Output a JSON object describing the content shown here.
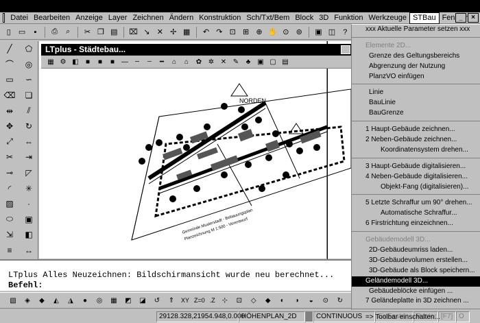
{
  "menubar": {
    "items": [
      "Datei",
      "Bearbeiten",
      "Anzeige",
      "Layer",
      "Zeichnen",
      "Ändern",
      "Konstruktion",
      "Sch/Txt/Bem",
      "Block",
      "3D",
      "Funktion",
      "Werkzeuge",
      "STBau",
      "Fenster",
      "?"
    ],
    "active_item": "STBau"
  },
  "drawing_window": {
    "title": "LTplus - Städtebau..."
  },
  "command_line": {
    "history": "LTplus Alles Neuzeichnen: Bildschirmansicht wurde neu berechnet...",
    "prompt": "Befehl:"
  },
  "status_bar": {
    "coordinates": "29128.328,21954.948,0.000",
    "layer": "HÖHENPLAN_2D",
    "linetype": "CONTINUOUS",
    "snap": "EinFasten",
    "grid": "Raster",
    "f7": "[F7]",
    "extra": "O"
  },
  "bottom_toolbar": {
    "xy": "XY",
    "z0": "Z=0",
    "z": ".Z"
  },
  "stbau_menu": {
    "items": [
      {
        "label": "xxx Aktuelle Parameter setzen xxx",
        "type": "item"
      },
      {
        "type": "sep"
      },
      {
        "label": "Elemente 2D...",
        "type": "disabled"
      },
      {
        "label": "Grenze des Geltungsbereichs",
        "type": "item"
      },
      {
        "label": "Abgrenzung der Nutzung",
        "type": "item"
      },
      {
        "label": "PlanzVO einfügen",
        "type": "item"
      },
      {
        "type": "sep"
      },
      {
        "label": "Linie",
        "type": "item"
      },
      {
        "label": "BauLinie",
        "type": "item"
      },
      {
        "label": "BauGrenze",
        "type": "item"
      },
      {
        "type": "sep"
      },
      {
        "label": "1 Haupt-Gebäude zeichnen...",
        "type": "item"
      },
      {
        "label": "2 Neben-Gebäude zeichnen...",
        "type": "item"
      },
      {
        "label": "Koordinatensystem drehen...",
        "type": "item"
      },
      {
        "type": "sep"
      },
      {
        "label": "3 Haupt-Gebäude digitalisieren...",
        "type": "item"
      },
      {
        "label": "4 Neben-Gebäude digitalisieren...",
        "type": "item"
      },
      {
        "label": "Objekt-Fang (digitalisieren)...",
        "type": "item"
      },
      {
        "type": "sep"
      },
      {
        "label": "5 Letzte Schraffur um 90° drehen...",
        "type": "item"
      },
      {
        "label": "Automatische Schraffur...",
        "type": "item"
      },
      {
        "label": "6 Firstrichtung einzeichnen...",
        "type": "item"
      },
      {
        "type": "sep"
      },
      {
        "label": "Gebäudemodell 3D...",
        "type": "disabled"
      },
      {
        "label": "2D-Gebäudeumriss laden...",
        "type": "item"
      },
      {
        "label": "3D-Gebäudevolumen erstellen...",
        "type": "item"
      },
      {
        "label": "3D-Gebäude als Block speichern...",
        "type": "item"
      },
      {
        "label": "Geländemodell 3D...",
        "type": "highlight"
      },
      {
        "label": "Gebäudeblöcke einfügen ...",
        "type": "item"
      },
      {
        "label": "7 Geländeplatte in 3D zeichnen ...",
        "type": "item"
      },
      {
        "type": "sep"
      },
      {
        "label": "=> Toolbar einschalten...",
        "type": "item"
      }
    ]
  },
  "drawing": {
    "north_label": "NORDEN",
    "sheet_caption_1": "Gemeinde Musterstadt - Bebauungsplan",
    "sheet_caption_2": "Planzeichnung M 1:500 - Vorentwurf"
  },
  "colors": {
    "title_bg": "#000000",
    "face": "#c0c0c0",
    "highlight": "#000000"
  }
}
